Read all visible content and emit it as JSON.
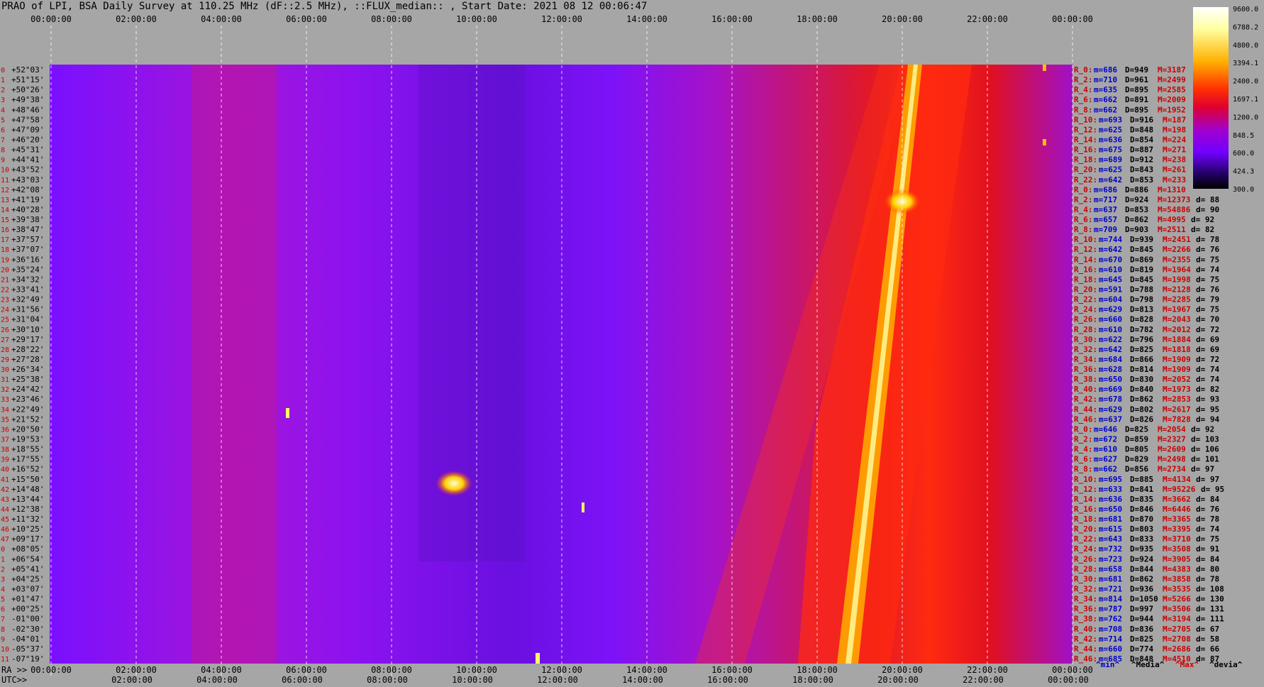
{
  "title": "PRAO of LPI, BSA Daily Survey at 110.25 MHz (dF::2.5 MHz), ::FLUX_median:: , Start Date: 2021 08 12 00:06:47",
  "ra_label": "RA >>",
  "utc_label": "UTC>>",
  "colors": {
    "background": "#a6a6a6",
    "heat_low": "#7a10ff",
    "heat_mid": "#ff1010",
    "heat_high": "#ffffa0"
  },
  "chart_data": {
    "type": "heatmap",
    "top_ticks": [
      "00:00:00",
      "02:00:00",
      "04:00:00",
      "06:00:00",
      "08:00:00",
      "10:00:00",
      "12:00:00",
      "14:00:00",
      "16:00:00",
      "18:00:00",
      "20:00:00",
      "22:00:00",
      "00:00:00"
    ],
    "ra_ticks": [
      "00:00:00",
      "02:00:00",
      "04:00:00",
      "06:00:00",
      "08:00:00",
      "10:00:00",
      "12:00:00",
      "14:00:00",
      "16:00:00",
      "18:00:00",
      "20:00:00",
      "22:00:00",
      "00:00:00"
    ],
    "utc_ticks": [
      "02:00:00",
      "04:00:00",
      "06:00:00",
      "08:00:00",
      "10:00:00",
      "12:00:00",
      "14:00:00",
      "16:00:00",
      "18:00:00",
      "20:00:00",
      "22:00:00",
      "00:00:00"
    ],
    "declinations": [
      "+52°03'",
      "+51°15'",
      "+50°26'",
      "+49°38'",
      "+48°46'",
      "+47°58'",
      "+47°09'",
      "+46°20'",
      "+45°31'",
      "+44°41'",
      "+43°52'",
      "+43°03'",
      "+42°08'",
      "+41°19'",
      "+40°28'",
      "+39°38'",
      "+38°47'",
      "+37°57'",
      "+37°07'",
      "+36°16'",
      "+35°24'",
      "+34°32'",
      "+33°41'",
      "+32°49'",
      "+31°56'",
      "+31°04'",
      "+30°10'",
      "+29°17'",
      "+28°22'",
      "+27°28'",
      "+26°34'",
      "+25°38'",
      "+24°42'",
      "+23°46'",
      "+22°49'",
      "+21°52'",
      "+20°50'",
      "+19°53'",
      "+18°55'",
      "+17°55'",
      "+16°52'",
      "+15°50'",
      "+14°48'",
      "+13°44'",
      "+12°38'",
      "+11°32'",
      "+10°25'",
      "+09°17'",
      "+08°05'",
      "+06°54'",
      "+05°41'",
      "+04°25'",
      "+03°07'",
      "+01°47'",
      "+00°25'",
      "-01°00'",
      "-02°30'",
      "-04°01'",
      "-05°37'",
      "-07°19'"
    ],
    "colorbar": {
      "labels": [
        "9600.0",
        "6788.2",
        "4800.0",
        "3394.1",
        "2400.0",
        "1697.1",
        "1200.0",
        "848.5",
        "600.0",
        "424.3",
        "300.0"
      ],
      "min": 300.0,
      "max": 9600.0,
      "scale": "log"
    },
    "stats": [
      {
        "r": "R_0:",
        "m": "686",
        "D": "949",
        "M": "3187",
        "d": ""
      },
      {
        "r": "R_2:",
        "m": "710",
        "D": "961",
        "M": "2499",
        "d": ""
      },
      {
        "r": "R_4:",
        "m": "635",
        "D": "895",
        "M": "2585",
        "d": ""
      },
      {
        "r": "R_6:",
        "m": "662",
        "D": "891",
        "M": "2009",
        "d": ""
      },
      {
        "r": "R_8:",
        "m": "662",
        "D": "895",
        "M": "1952",
        "d": ""
      },
      {
        "r": "R_10:",
        "m": "693",
        "D": "916",
        "M": "187",
        "d": ""
      },
      {
        "r": "R_12:",
        "m": "625",
        "D": "848",
        "M": "198",
        "d": ""
      },
      {
        "r": "R_14:",
        "m": "636",
        "D": "854",
        "M": "224",
        "d": ""
      },
      {
        "r": "R_16:",
        "m": "675",
        "D": "887",
        "M": "271",
        "d": ""
      },
      {
        "r": "R_18:",
        "m": "689",
        "D": "912",
        "M": "238",
        "d": ""
      },
      {
        "r": "R_20:",
        "m": "625",
        "D": "843",
        "M": "261",
        "d": ""
      },
      {
        "r": "R_22:",
        "m": "642",
        "D": "853",
        "M": "233",
        "d": ""
      },
      {
        "r": "R_0:",
        "m": "686",
        "D": "886",
        "M": "1310",
        "d": ""
      },
      {
        "r": "R_2:",
        "m": "717",
        "D": "924",
        "M": "12373",
        "d": "88"
      },
      {
        "r": "R_4:",
        "m": "637",
        "D": "853",
        "M": "54886",
        "d": "90"
      },
      {
        "r": "R_6:",
        "m": "657",
        "D": "862",
        "M": "4995",
        "d": "92"
      },
      {
        "r": "R_8:",
        "m": "709",
        "D": "903",
        "M": "2511",
        "d": "82"
      },
      {
        "r": "R_10:",
        "m": "744",
        "D": "939",
        "M": "2451",
        "d": "78"
      },
      {
        "r": "R_12:",
        "m": "642",
        "D": "845",
        "M": "2266",
        "d": "76"
      },
      {
        "r": "R_14:",
        "m": "670",
        "D": "869",
        "M": "2355",
        "d": "75"
      },
      {
        "r": "R_16:",
        "m": "610",
        "D": "819",
        "M": "1964",
        "d": "74"
      },
      {
        "r": "R_18:",
        "m": "645",
        "D": "845",
        "M": "1998",
        "d": "75"
      },
      {
        "r": "R_20:",
        "m": "591",
        "D": "788",
        "M": "2128",
        "d": "76"
      },
      {
        "r": "R_22:",
        "m": "604",
        "D": "798",
        "M": "2285",
        "d": "79"
      },
      {
        "r": "R_24:",
        "m": "629",
        "D": "813",
        "M": "1967",
        "d": "75"
      },
      {
        "r": "R_26:",
        "m": "660",
        "D": "828",
        "M": "2043",
        "d": "70"
      },
      {
        "r": "R_28:",
        "m": "610",
        "D": "782",
        "M": "2012",
        "d": "72"
      },
      {
        "r": "R_30:",
        "m": "622",
        "D": "796",
        "M": "1884",
        "d": "69"
      },
      {
        "r": "R_32:",
        "m": "642",
        "D": "825",
        "M": "1818",
        "d": "69"
      },
      {
        "r": "R_34:",
        "m": "684",
        "D": "866",
        "M": "1909",
        "d": "72"
      },
      {
        "r": "R_36:",
        "m": "628",
        "D": "814",
        "M": "1909",
        "d": "74"
      },
      {
        "r": "R_38:",
        "m": "650",
        "D": "830",
        "M": "2052",
        "d": "74"
      },
      {
        "r": "R_40:",
        "m": "669",
        "D": "840",
        "M": "1973",
        "d": "82"
      },
      {
        "r": "R_42:",
        "m": "678",
        "D": "862",
        "M": "2853",
        "d": "93"
      },
      {
        "r": "R_44:",
        "m": "629",
        "D": "802",
        "M": "2617",
        "d": "95"
      },
      {
        "r": "R_46:",
        "m": "637",
        "D": "826",
        "M": "7828",
        "d": "94"
      },
      {
        "r": "R_0:",
        "m": "646",
        "D": "825",
        "M": "2054",
        "d": "92"
      },
      {
        "r": "R_2:",
        "m": "672",
        "D": "859",
        "M": "2327",
        "d": "103"
      },
      {
        "r": "R_4:",
        "m": "610",
        "D": "805",
        "M": "2609",
        "d": "106"
      },
      {
        "r": "R_6:",
        "m": "627",
        "D": "829",
        "M": "2498",
        "d": "101"
      },
      {
        "r": "R_8:",
        "m": "662",
        "D": "856",
        "M": "2734",
        "d": "97"
      },
      {
        "r": "R_10:",
        "m": "695",
        "D": "885",
        "M": "4134",
        "d": "97"
      },
      {
        "r": "R_12:",
        "m": "633",
        "D": "841",
        "M": "95226",
        "d": "95"
      },
      {
        "r": "R_14:",
        "m": "636",
        "D": "835",
        "M": "3662",
        "d": "84"
      },
      {
        "r": "R_16:",
        "m": "650",
        "D": "846",
        "M": "6446",
        "d": "76"
      },
      {
        "r": "R_18:",
        "m": "681",
        "D": "870",
        "M": "3365",
        "d": "78"
      },
      {
        "r": "R_20:",
        "m": "615",
        "D": "803",
        "M": "3395",
        "d": "74"
      },
      {
        "r": "R_22:",
        "m": "643",
        "D": "833",
        "M": "3710",
        "d": "75"
      },
      {
        "r": "R_24:",
        "m": "732",
        "D": "935",
        "M": "3508",
        "d": "91"
      },
      {
        "r": "R_26:",
        "m": "723",
        "D": "924",
        "M": "3905",
        "d": "84"
      },
      {
        "r": "R_28:",
        "m": "658",
        "D": "844",
        "M": "4383",
        "d": "80"
      },
      {
        "r": "R_30:",
        "m": "681",
        "D": "862",
        "M": "3858",
        "d": "78"
      },
      {
        "r": "R_32:",
        "m": "721",
        "D": "936",
        "M": "3535",
        "d": "108"
      },
      {
        "r": "R_34:",
        "m": "814",
        "D": "1050",
        "M": "5266",
        "d": "130"
      },
      {
        "r": "R_36:",
        "m": "787",
        "D": "997",
        "M": "3506",
        "d": "131"
      },
      {
        "r": "R_38:",
        "m": "762",
        "D": "944",
        "M": "3194",
        "d": "111"
      },
      {
        "r": "R_40:",
        "m": "708",
        "D": "836",
        "M": "2705",
        "d": "67"
      },
      {
        "r": "R_42:",
        "m": "714",
        "D": "825",
        "M": "2708",
        "d": "58"
      },
      {
        "r": "R_44:",
        "m": "660",
        "D": "774",
        "M": "2686",
        "d": "66"
      },
      {
        "r": "R_46:",
        "m": "685",
        "D": "848",
        "M": "4510",
        "d": "87"
      }
    ],
    "legend": {
      "min": "^min^",
      "median": "^Media^",
      "max": "^Max^",
      "devia": "^devia^"
    }
  }
}
